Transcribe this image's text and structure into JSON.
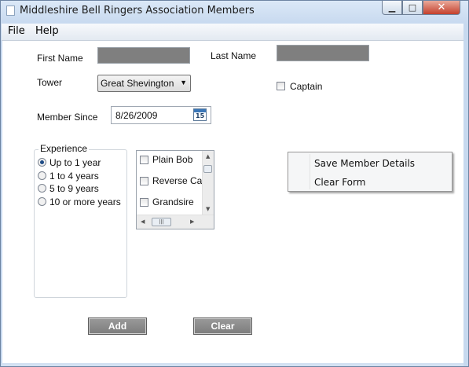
{
  "window": {
    "title": "Middleshire Bell Ringers Association Members",
    "min_glyph": "▁",
    "max_glyph": "□",
    "close_glyph": "✕"
  },
  "menu": {
    "items": [
      "File",
      "Help"
    ]
  },
  "form": {
    "first_name_label": "First Name",
    "last_name_label": "Last Name",
    "tower_label": "Tower",
    "tower_value": "Great Shevington",
    "captain_label": "Captain",
    "member_since_label": "Member Since",
    "member_since_value": "8/26/2009",
    "calendar_day": "15"
  },
  "experience": {
    "title": "Experience",
    "options": [
      "Up to 1 year",
      "1 to 4 years",
      "5 to 9 years",
      "10 or more years"
    ],
    "selected_index": 0
  },
  "methods": {
    "items": [
      "Plain Bob",
      "Reverse Canterbury",
      "Grandsire"
    ]
  },
  "context_menu": {
    "items": [
      "Save Member Details",
      "Clear Form"
    ]
  },
  "buttons": {
    "add": "Add",
    "clear": "Clear"
  },
  "colors": {
    "field_fill": "#7f7f7f",
    "button_fill": "#8a8a8a",
    "radio_selected": "#1d4b86"
  }
}
